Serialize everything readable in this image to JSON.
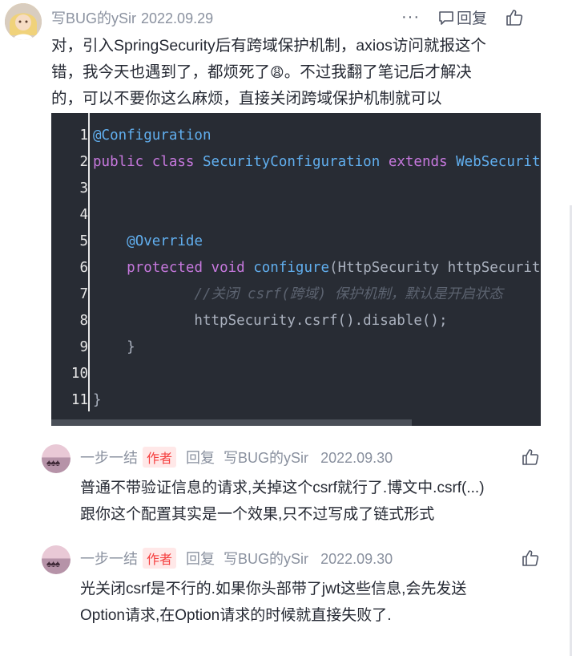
{
  "comment": {
    "author": "写BUG的ySir",
    "date": "2022.09.29",
    "more_label": "···",
    "reply_label": "回复",
    "text_lines": [
      "对，引入SpringSecurity后有跨域保护机制，axios访问就报这个",
      "错，我今天也遇到了，都烦死了",
      "。不过我翻了笔记后才解决",
      "的，可以不要你这么麻烦，直接关闭跨域保护机制就可以"
    ],
    "emoji": "😩"
  },
  "code": {
    "line_numbers": [
      "1",
      "2",
      "3",
      "4",
      "5",
      "6",
      "7",
      "8",
      "9",
      "10",
      "11"
    ],
    "lines": [
      {
        "parts": [
          {
            "t": "@Configuration",
            "c": "ann"
          }
        ]
      },
      {
        "parts": [
          {
            "t": "public",
            "c": "kw"
          },
          {
            "t": " ",
            "c": ""
          },
          {
            "t": "class",
            "c": "kw"
          },
          {
            "t": " ",
            "c": ""
          },
          {
            "t": "SecurityConfiguration",
            "c": "cls"
          },
          {
            "t": " ",
            "c": ""
          },
          {
            "t": "extends",
            "c": "kw"
          },
          {
            "t": " ",
            "c": ""
          },
          {
            "t": "WebSecurityConfigurerAdapter",
            "c": "cls"
          }
        ]
      },
      {
        "parts": []
      },
      {
        "parts": []
      },
      {
        "parts": [
          {
            "t": "    ",
            "c": ""
          },
          {
            "t": "@Override",
            "c": "ann"
          }
        ]
      },
      {
        "parts": [
          {
            "t": "    ",
            "c": ""
          },
          {
            "t": "protected",
            "c": "kw"
          },
          {
            "t": " ",
            "c": ""
          },
          {
            "t": "void",
            "c": "kw"
          },
          {
            "t": " ",
            "c": ""
          },
          {
            "t": "configure",
            "c": "cls"
          },
          {
            "t": "(HttpSecurity httpSecurity) throws Exception {",
            "c": ""
          }
        ]
      },
      {
        "parts": [
          {
            "t": "            ",
            "c": ""
          },
          {
            "t": "//关闭 csrf(跨域) 保护机制，默认是开启状态",
            "c": "cm"
          }
        ]
      },
      {
        "parts": [
          {
            "t": "            httpSecurity.csrf().disable();",
            "c": ""
          }
        ]
      },
      {
        "parts": [
          {
            "t": "    }",
            "c": ""
          }
        ]
      },
      {
        "parts": []
      },
      {
        "parts": [
          {
            "t": "}",
            "c": ""
          }
        ]
      }
    ]
  },
  "replies": [
    {
      "author": "一步一结",
      "author_tag": "作者",
      "reply_label": "回复",
      "reply_to": "写BUG的ySir",
      "date": "2022.09.30",
      "text_lines": [
        "普通不带验证信息的请求,关掉这个csrf就行了.博文中.csrf(...)",
        "跟你这个配置其实是一个效果,只不过写成了链式形式"
      ]
    },
    {
      "author": "一步一结",
      "author_tag": "作者",
      "reply_label": "回复",
      "reply_to": "写BUG的ySir",
      "date": "2022.09.30",
      "text_lines": [
        "光关闭csrf是不行的.如果你头部带了jwt这些信息,会先发送",
        "Option请求,在Option请求的时候就直接失败了."
      ]
    }
  ]
}
